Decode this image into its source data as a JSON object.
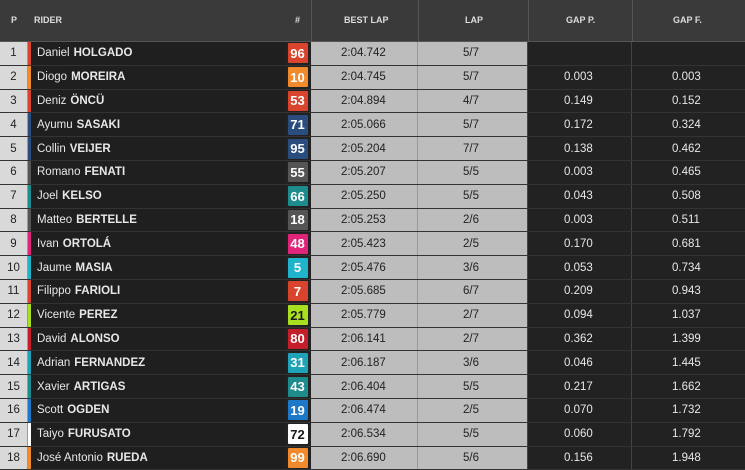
{
  "header": {
    "pos": "P",
    "rider": "RIDER",
    "num": "#",
    "best_lap": "BEST LAP",
    "lap": "LAP",
    "gap_prev": "GAP P.",
    "gap_first": "GAP F."
  },
  "rows": [
    {
      "pos": "1",
      "first": "Daniel",
      "last": "HOLGADO",
      "num": "96",
      "num_bg": "#d9442c",
      "num_fg": "#ffffff",
      "stripe": "#d9442c",
      "best": "2:04.742",
      "lap": "5/7",
      "gapp": "",
      "gapf": "",
      "marker": false
    },
    {
      "pos": "2",
      "first": "Diogo",
      "last": "MOREIRA",
      "num": "10",
      "num_bg": "#f08a2c",
      "num_fg": "#ffffff",
      "stripe": "#f08a2c",
      "best": "2:04.745",
      "lap": "5/7",
      "gapp": "0.003",
      "gapf": "0.003",
      "marker": false
    },
    {
      "pos": "3",
      "first": "Deniz",
      "last": "ÖNCÜ",
      "num": "53",
      "num_bg": "#d9442c",
      "num_fg": "#ffffff",
      "stripe": "#d9442c",
      "best": "2:04.894",
      "lap": "4/7",
      "gapp": "0.149",
      "gapf": "0.152",
      "marker": false
    },
    {
      "pos": "4",
      "first": "Ayumu",
      "last": "SASAKI",
      "num": "71",
      "num_bg": "#2b4d7e",
      "num_fg": "#ffffff",
      "stripe": "#2b4d7e",
      "best": "2:05.066",
      "lap": "5/7",
      "gapp": "0.172",
      "gapf": "0.324",
      "marker": false
    },
    {
      "pos": "5",
      "first": "Collin",
      "last": "VEIJER",
      "num": "95",
      "num_bg": "#2b4d7e",
      "num_fg": "#ffffff",
      "stripe": "#2b4d7e",
      "best": "2:05.204",
      "lap": "7/7",
      "gapp": "0.138",
      "gapf": "0.462",
      "marker": true
    },
    {
      "pos": "6",
      "first": "Romano",
      "last": "FENATI",
      "num": "55",
      "num_bg": "#555555",
      "num_fg": "#ffffff",
      "stripe": "#555555",
      "best": "2:05.207",
      "lap": "5/5",
      "gapp": "0.003",
      "gapf": "0.465",
      "marker": false
    },
    {
      "pos": "7",
      "first": "Joel",
      "last": "KELSO",
      "num": "66",
      "num_bg": "#1e8c8c",
      "num_fg": "#ffffff",
      "stripe": "#1e8c8c",
      "best": "2:05.250",
      "lap": "5/5",
      "gapp": "0.043",
      "gapf": "0.508",
      "marker": true
    },
    {
      "pos": "8",
      "first": "Matteo",
      "last": "BERTELLE",
      "num": "18",
      "num_bg": "#555555",
      "num_fg": "#ffffff",
      "stripe": "#555555",
      "best": "2:05.253",
      "lap": "2/6",
      "gapp": "0.003",
      "gapf": "0.511",
      "marker": false
    },
    {
      "pos": "9",
      "first": "Ivan",
      "last": "ORTOLÁ",
      "num": "48",
      "num_bg": "#e0247a",
      "num_fg": "#ffffff",
      "stripe": "#e0247a",
      "best": "2:05.423",
      "lap": "2/5",
      "gapp": "0.170",
      "gapf": "0.681",
      "marker": false
    },
    {
      "pos": "10",
      "first": "Jaume",
      "last": "MASIA",
      "num": "5",
      "num_bg": "#1fb3cc",
      "num_fg": "#ffffff",
      "stripe": "#1fb3cc",
      "best": "2:05.476",
      "lap": "3/6",
      "gapp": "0.053",
      "gapf": "0.734",
      "marker": false
    },
    {
      "pos": "11",
      "first": "Filippo",
      "last": "FARIOLI",
      "num": "7",
      "num_bg": "#d9442c",
      "num_fg": "#ffffff",
      "stripe": "#d9442c",
      "best": "2:05.685",
      "lap": "6/7",
      "gapp": "0.209",
      "gapf": "0.943",
      "marker": false
    },
    {
      "pos": "12",
      "first": "Vicente",
      "last": "PEREZ",
      "num": "21",
      "num_bg": "#a8e020",
      "num_fg": "#1a1a1a",
      "stripe": "#a8e020",
      "best": "2:05.779",
      "lap": "2/7",
      "gapp": "0.094",
      "gapf": "1.037",
      "marker": false
    },
    {
      "pos": "13",
      "first": "David",
      "last": "ALONSO",
      "num": "80",
      "num_bg": "#c41e2a",
      "num_fg": "#ffffff",
      "stripe": "#c41e2a",
      "best": "2:06.141",
      "lap": "2/7",
      "gapp": "0.362",
      "gapf": "1.399",
      "marker": true
    },
    {
      "pos": "14",
      "first": "Adrian",
      "last": "FERNANDEZ",
      "num": "31",
      "num_bg": "#1fa3b8",
      "num_fg": "#ffffff",
      "stripe": "#1fa3b8",
      "best": "2:06.187",
      "lap": "3/6",
      "gapp": "0.046",
      "gapf": "1.445",
      "marker": false
    },
    {
      "pos": "15",
      "first": "Xavier",
      "last": "ARTIGAS",
      "num": "43",
      "num_bg": "#1e8c8c",
      "num_fg": "#ffffff",
      "stripe": "#1e8c8c",
      "best": "2:06.404",
      "lap": "5/5",
      "gapp": "0.217",
      "gapf": "1.662",
      "marker": true
    },
    {
      "pos": "16",
      "first": "Scott",
      "last": "OGDEN",
      "num": "19",
      "num_bg": "#1e78c8",
      "num_fg": "#ffffff",
      "stripe": "#1e78c8",
      "best": "2:06.474",
      "lap": "2/5",
      "gapp": "0.070",
      "gapf": "1.732",
      "marker": false
    },
    {
      "pos": "17",
      "first": "Taiyo",
      "last": "FURUSATO",
      "num": "72",
      "num_bg": "#ffffff",
      "num_fg": "#1a1a1a",
      "stripe": "#ffffff",
      "best": "2:06.534",
      "lap": "5/5",
      "gapp": "0.060",
      "gapf": "1.792",
      "marker": false
    },
    {
      "pos": "18",
      "first": "José Antonio",
      "last": "RUEDA",
      "num": "99",
      "num_bg": "#f08a2c",
      "num_fg": "#ffffff",
      "stripe": "#f08a2c",
      "best": "2:06.690",
      "lap": "5/6",
      "gapp": "0.156",
      "gapf": "1.948",
      "marker": true
    }
  ]
}
